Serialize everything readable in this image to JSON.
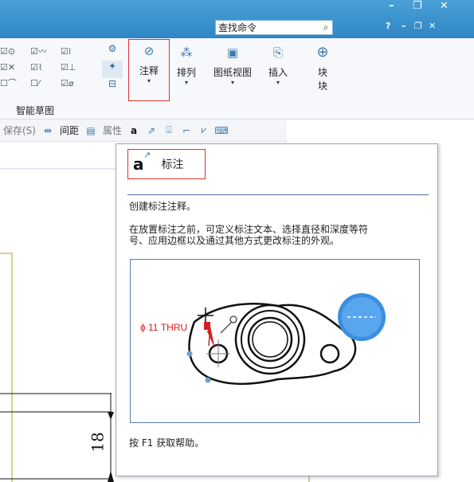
{
  "titlebar": {
    "search_placeholder": "查找命令",
    "search_icon": "search-icon",
    "controls_top": [
      "–",
      "❐",
      "✕"
    ],
    "controls_sub": "? – ❐ ✕",
    "color": "#2f86c4"
  },
  "ribbon": {
    "sketch_group_label": "智能草图",
    "sketch_rows": [
      [
        "☑⊙",
        "☑〰",
        "☑⁞"
      ],
      [
        "☑✕",
        "☑⌇",
        "☑⊥"
      ],
      [
        "☐⌒",
        "☐⁄",
        "☑⌀"
      ]
    ],
    "buttons": {
      "notes": "注释",
      "pattern": "排列",
      "drawing_views": "图纸视图",
      "insert": "插入",
      "block_line1": "块",
      "block_line2": "块"
    }
  },
  "toolbar2": {
    "save": "保存(S)",
    "spacing": "间距",
    "properties": "属性"
  },
  "tooltip": {
    "title": "标注",
    "description": "创建标注注释。",
    "detail_line1": "在放置标注之前，可定义标注文本、选择直径和深度等符",
    "detail_line2": "号、应用边框以及通过其他方式更改标注的外观。",
    "help": "按 F1 获取帮助。",
    "preview_label": "ϕ 11 THRU"
  },
  "drawing": {
    "dimension_value": "18"
  },
  "colors": {
    "highlight_red": "#e03030",
    "accent_blue": "#3d7ab0"
  }
}
